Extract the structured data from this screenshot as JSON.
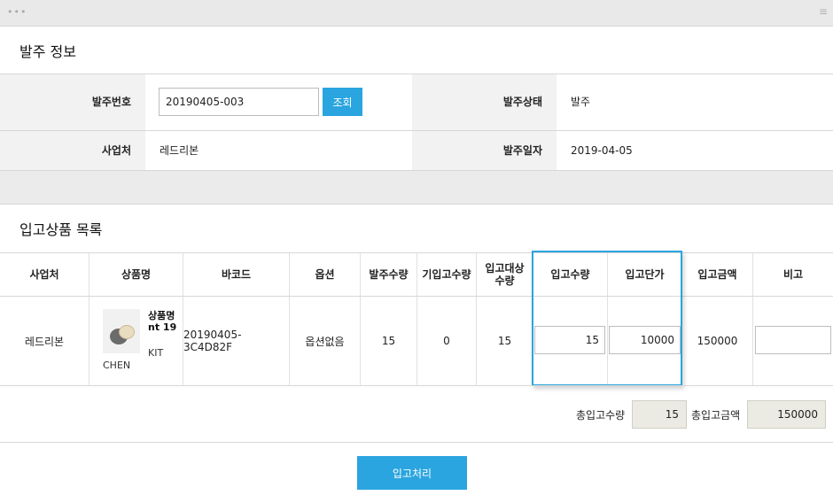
{
  "window": {
    "dots": "•••",
    "menu": "≡"
  },
  "order_info": {
    "title": "발주 정보",
    "order_no_label": "발주번호",
    "order_no_value": "20190405-003",
    "lookup_button": "조회",
    "status_label": "발주상태",
    "status_value": "발주",
    "supplier_label": "사업처",
    "supplier_value": "레드리본",
    "date_label": "발주일자",
    "date_value": "2019-04-05"
  },
  "receipt_list": {
    "title": "입고상품 목록",
    "headers": [
      "사업처",
      "상품명",
      "바코드",
      "옵션",
      "발주수량",
      "기입고수량",
      "입고대상\n수량",
      "입고수량",
      "입고단가",
      "입고금액",
      "비고"
    ],
    "rows": [
      {
        "supplier": "레드리본",
        "product_name": "상품명nt 19",
        "product_sub": "KIT",
        "brand": "CHEN",
        "barcode": "20190405-3C4D82F",
        "option": "옵션없음",
        "order_qty": "15",
        "prev_received_qty": "0",
        "target_qty": "15",
        "receive_qty": "15",
        "unit_price": "10000",
        "amount": "150000",
        "note": ""
      }
    ]
  },
  "totals": {
    "qty_label": "총입고수량",
    "qty_value": "15",
    "amount_label": "총입고금액",
    "amount_value": "150000"
  },
  "process_button": "입고처리",
  "colors": {
    "accent": "#2aa5df",
    "label_bg": "#f2f2f2",
    "readonly_bg": "#ebebe3"
  }
}
